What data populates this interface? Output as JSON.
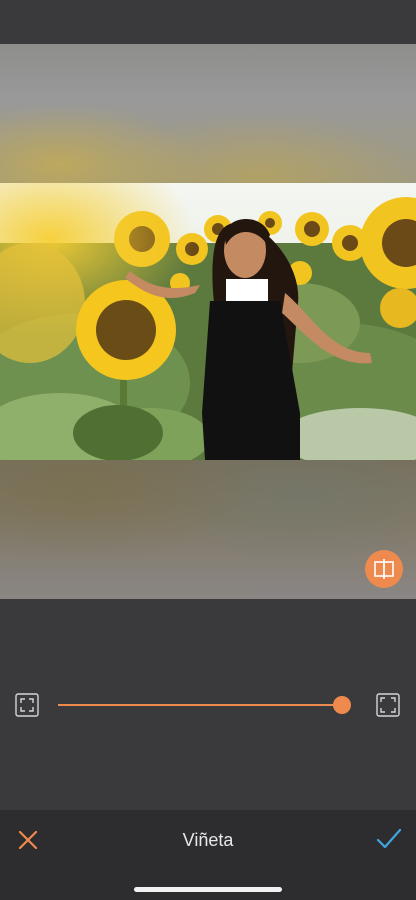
{
  "editor": {
    "tool_title": "Viñeta",
    "intensity": 0.98,
    "accent_color": "#ef8a4e",
    "confirm_color": "#3fa7e0"
  },
  "icons": {
    "compare": "split-compare-icon",
    "min": "frame-corners-icon",
    "max": "frame-corners-icon",
    "cancel": "close-icon",
    "confirm": "checkmark-icon"
  }
}
